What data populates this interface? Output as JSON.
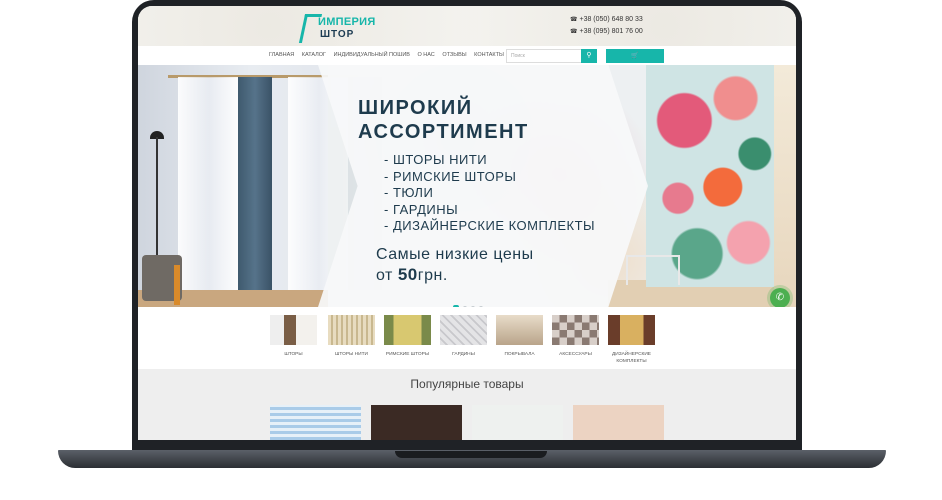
{
  "header": {
    "logo_line1": "ИМПЕРИЯ",
    "logo_line2": "ШТОР",
    "phones": [
      "+38 (050) 648 80 33",
      "+38 (095) 801 76 00"
    ]
  },
  "nav": {
    "links": [
      "ГЛАВНАЯ",
      "КАТАЛОГ",
      "ИНДИВИДУАЛЬНЫЙ ПОШИВ",
      "О НАС",
      "ОТЗЫВЫ",
      "КОНТАКТЫ"
    ],
    "search_placeholder": "Поиск",
    "search_icon": "search-icon",
    "cart_icon": "cart-icon"
  },
  "hero": {
    "title_line1": "ШИРОКИЙ",
    "title_line2": "АССОРТИМЕНТ",
    "items": [
      "- ШТОРЫ НИТИ",
      "- РИМСКИЕ ШТОРЫ",
      "- ТЮЛИ",
      "- ГАРДИНЫ",
      "- ДИЗАЙНЕРСКИЕ КОМПЛЕКТЫ"
    ],
    "price_line1": "Самые низкие цены",
    "price_prefix": "от ",
    "price_value": "50",
    "price_suffix": "грн.",
    "slides_count": 4,
    "active_slide": 1
  },
  "categories": [
    {
      "label": "ШТОРЫ",
      "color": "#c9c1b7"
    },
    {
      "label": "ШТОРЫ НИТИ",
      "color": "#d7c9a8"
    },
    {
      "label": "РИМСКИЕ ШТОРЫ",
      "color": "#c8b65c"
    },
    {
      "label": "ГАРДИНЫ",
      "color": "#d6d6d8"
    },
    {
      "label": "ПОКРЫВАЛА",
      "color": "#c8b9a3"
    },
    {
      "label": "АКСЕССУАРЫ",
      "color": "#9d8f86"
    },
    {
      "label": "ДИЗАЙНЕРСКИЕ КОМПЛЕКТЫ",
      "color": "#b58f4a"
    }
  ],
  "popular": {
    "title": "Популярные товары",
    "products": [
      {
        "color": "#a9cbe8"
      },
      {
        "color": "#3b2a24"
      },
      {
        "color": "#eef1ef"
      },
      {
        "color": "#ecd3c2"
      }
    ]
  },
  "colors": {
    "accent": "#17b6aa",
    "text_dark": "#1e3b4d",
    "call": "#4caf50"
  }
}
